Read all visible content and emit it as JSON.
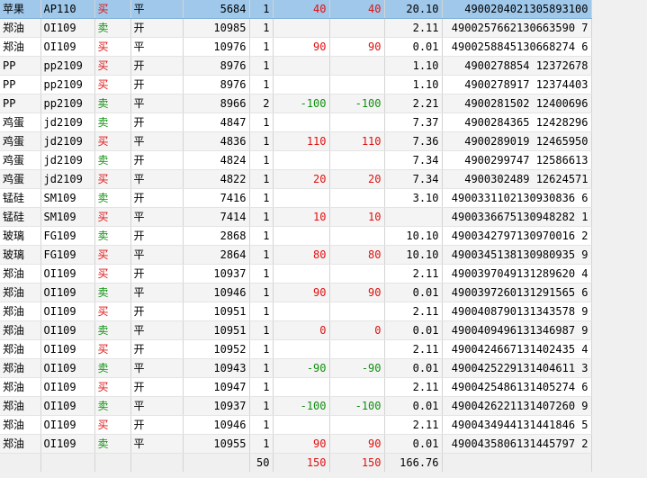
{
  "colors": {
    "buy": "#e01010",
    "sell": "#109010",
    "selected_row": "#9fc8ea"
  },
  "rows": [
    [
      "苹果",
      "AP110",
      "买",
      "平",
      "5684",
      "1",
      "40",
      "40",
      "20.10",
      "4900204021305893100"
    ],
    [
      "郑油",
      "OI109",
      "卖",
      "开",
      "10985",
      "1",
      "",
      "",
      "2.11",
      "4900257662130663590 7"
    ],
    [
      "郑油",
      "OI109",
      "买",
      "平",
      "10976",
      "1",
      "90",
      "90",
      "0.01",
      "4900258845130668274 6"
    ],
    [
      "PP",
      "pp2109",
      "买",
      "开",
      "8976",
      "1",
      "",
      "",
      "1.10",
      "4900278854 12372678"
    ],
    [
      "PP",
      "pp2109",
      "买",
      "开",
      "8976",
      "1",
      "",
      "",
      "1.10",
      "4900278917 12374403"
    ],
    [
      "PP",
      "pp2109",
      "卖",
      "平",
      "8966",
      "2",
      "-100",
      "-100",
      "2.21",
      "4900281502 12400696"
    ],
    [
      "鸡蛋",
      "jd2109",
      "卖",
      "开",
      "4847",
      "1",
      "",
      "",
      "7.37",
      "4900284365 12428296"
    ],
    [
      "鸡蛋",
      "jd2109",
      "买",
      "平",
      "4836",
      "1",
      "110",
      "110",
      "7.36",
      "4900289019 12465950"
    ],
    [
      "鸡蛋",
      "jd2109",
      "卖",
      "开",
      "4824",
      "1",
      "",
      "",
      "7.34",
      "4900299747 12586613"
    ],
    [
      "鸡蛋",
      "jd2109",
      "买",
      "平",
      "4822",
      "1",
      "20",
      "20",
      "7.34",
      "4900302489 12624571"
    ],
    [
      "锰硅",
      "SM109",
      "卖",
      "开",
      "7416",
      "1",
      "",
      "",
      "3.10",
      "4900331102130930836 6"
    ],
    [
      "锰硅",
      "SM109",
      "买",
      "平",
      "7414",
      "1",
      "10",
      "10",
      "",
      "4900336675130948282 1"
    ],
    [
      "玻璃",
      "FG109",
      "卖",
      "开",
      "2868",
      "1",
      "",
      "",
      "10.10",
      "4900342797130970016 2"
    ],
    [
      "玻璃",
      "FG109",
      "买",
      "平",
      "2864",
      "1",
      "80",
      "80",
      "10.10",
      "4900345138130980935 9"
    ],
    [
      "郑油",
      "OI109",
      "买",
      "开",
      "10937",
      "1",
      "",
      "",
      "2.11",
      "4900397049131289620 4"
    ],
    [
      "郑油",
      "OI109",
      "卖",
      "平",
      "10946",
      "1",
      "90",
      "90",
      "0.01",
      "4900397260131291565 6"
    ],
    [
      "郑油",
      "OI109",
      "买",
      "开",
      "10951",
      "1",
      "",
      "",
      "2.11",
      "4900408790131343578 9"
    ],
    [
      "郑油",
      "OI109",
      "卖",
      "平",
      "10951",
      "1",
      "0",
      "0",
      "0.01",
      "4900409496131346987 9"
    ],
    [
      "郑油",
      "OI109",
      "买",
      "开",
      "10952",
      "1",
      "",
      "",
      "2.11",
      "4900424667131402435 4"
    ],
    [
      "郑油",
      "OI109",
      "卖",
      "平",
      "10943",
      "1",
      "-90",
      "-90",
      "0.01",
      "4900425229131404611 3"
    ],
    [
      "郑油",
      "OI109",
      "买",
      "开",
      "10947",
      "1",
      "",
      "",
      "2.11",
      "4900425486131405274 6"
    ],
    [
      "郑油",
      "OI109",
      "卖",
      "平",
      "10937",
      "1",
      "-100",
      "-100",
      "0.01",
      "4900426221131407260 9"
    ],
    [
      "郑油",
      "OI109",
      "买",
      "开",
      "10946",
      "1",
      "",
      "",
      "2.11",
      "4900434944131441846 5"
    ],
    [
      "郑油",
      "OI109",
      "卖",
      "平",
      "10955",
      "1",
      "90",
      "90",
      "0.01",
      "4900435806131445797 2"
    ]
  ],
  "totals": [
    "",
    "",
    "",
    "",
    "",
    "50",
    "150",
    "150",
    "166.76",
    ""
  ]
}
